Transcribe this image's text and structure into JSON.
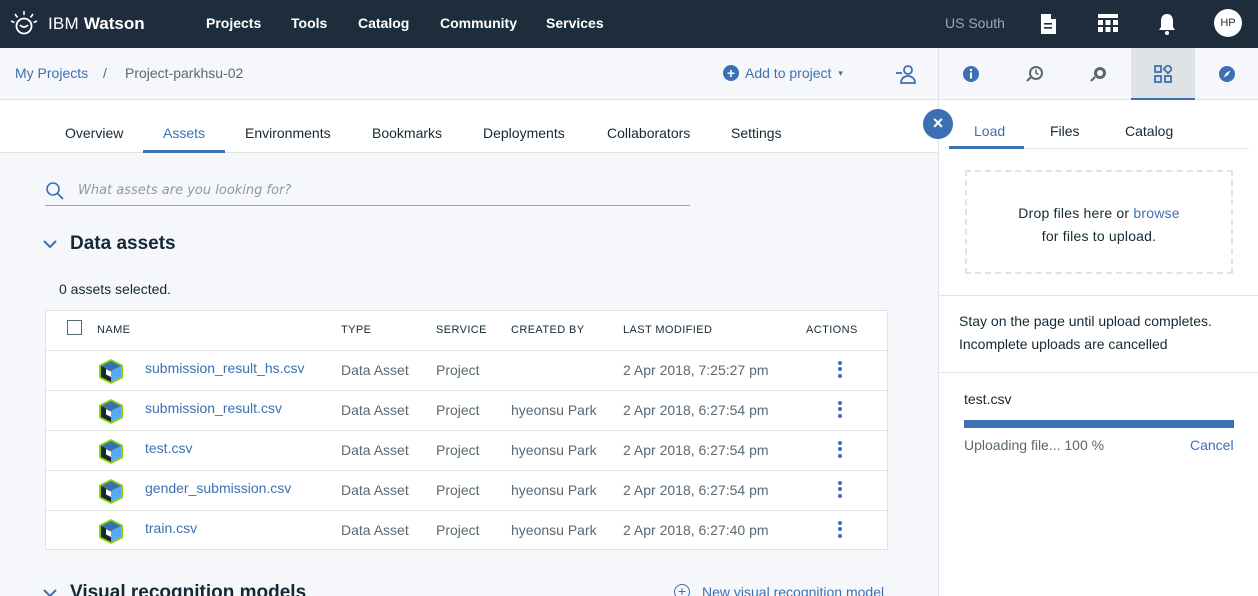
{
  "topnav": {
    "brand_prefix": "IBM",
    "brand_name": "Watson",
    "items": [
      {
        "label": "Projects"
      },
      {
        "label": "Tools"
      },
      {
        "label": "Catalog"
      },
      {
        "label": "Community"
      },
      {
        "label": "Services"
      }
    ],
    "region": "US South",
    "avatar_initials": "HP",
    "icons": [
      "docs-icon",
      "apps-icon",
      "notifications-icon"
    ]
  },
  "breadcrumb": {
    "parent": "My Projects",
    "separator": "/",
    "current": "Project-parkhsu-02",
    "add_label": "Add to project",
    "add_caret": "▾"
  },
  "tabs": [
    {
      "label": "Overview"
    },
    {
      "label": "Assets",
      "active": true
    },
    {
      "label": "Environments"
    },
    {
      "label": "Bookmarks"
    },
    {
      "label": "Deployments"
    },
    {
      "label": "Collaborators"
    },
    {
      "label": "Settings"
    }
  ],
  "search": {
    "placeholder": "What assets are you looking for?"
  },
  "data_assets": {
    "title": "Data assets",
    "selected_count": "0 assets selected.",
    "columns": {
      "name": "NAME",
      "type": "TYPE",
      "service": "SERVICE",
      "created_by": "CREATED BY",
      "last_modified": "LAST MODIFIED",
      "actions": "ACTIONS"
    },
    "rows": [
      {
        "name": "submission_result_hs.csv",
        "type": "Data Asset",
        "service": "Project",
        "created_by": "",
        "last_modified": "2 Apr 2018, 7:25:27 pm"
      },
      {
        "name": "submission_result.csv",
        "type": "Data Asset",
        "service": "Project",
        "created_by": "hyeonsu Park",
        "last_modified": "2 Apr 2018, 6:27:54 pm"
      },
      {
        "name": "test.csv",
        "type": "Data Asset",
        "service": "Project",
        "created_by": "hyeonsu Park",
        "last_modified": "2 Apr 2018, 6:27:54 pm"
      },
      {
        "name": "gender_submission.csv",
        "type": "Data Asset",
        "service": "Project",
        "created_by": "hyeonsu Park",
        "last_modified": "2 Apr 2018, 6:27:54 pm"
      },
      {
        "name": "train.csv",
        "type": "Data Asset",
        "service": "Project",
        "created_by": "hyeonsu Park",
        "last_modified": "2 Apr 2018, 6:27:40 pm"
      }
    ]
  },
  "visual_recognition": {
    "title": "Visual recognition models",
    "new_label": "New visual recognition model"
  },
  "right_panel": {
    "close_glyph": "×",
    "tools": [
      "info-icon",
      "recent-icon",
      "search-data-icon",
      "data-icon",
      "compass-icon"
    ],
    "tabs": [
      {
        "label": "Load",
        "active": true
      },
      {
        "label": "Files"
      },
      {
        "label": "Catalog"
      }
    ],
    "drop_text": "Drop files here or",
    "drop_browse": "browse",
    "drop_text2": "for files to upload.",
    "stay_line1": "Stay on the page until upload completes.",
    "stay_line2": "Incomplete uploads are cancelled",
    "upload_file": "test.csv",
    "upload_progress_percent": 100,
    "upload_status": "Uploading file... 100 %",
    "cancel_label": "Cancel"
  },
  "colors": {
    "nav_bg": "#1d2d3b",
    "accent": "#3d70b2",
    "page_bg": "#f5f7fa"
  }
}
